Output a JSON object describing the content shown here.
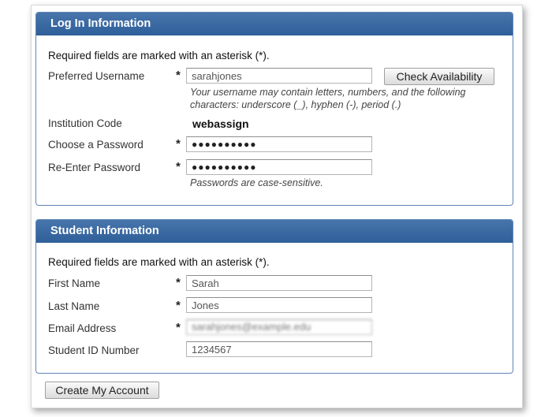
{
  "login_section": {
    "title": "Log In Information",
    "required_note": "Required fields are marked with an asterisk (*).",
    "username": {
      "label": "Preferred Username",
      "required_mark": "*",
      "value": "sarahjones",
      "check_button": "Check Availability",
      "hint_line1": "Your username may contain letters, numbers, and the following",
      "hint_line2": "characters: underscore (_), hyphen (-), period (.)"
    },
    "institution": {
      "label": "Institution Code",
      "value": "webassign"
    },
    "password": {
      "label": "Choose a Password",
      "required_mark": "*",
      "value": "●●●●●●●●●●"
    },
    "password_confirm": {
      "label": "Re-Enter Password",
      "required_mark": "*",
      "value": "●●●●●●●●●●"
    },
    "password_hint": "Passwords are case-sensitive."
  },
  "student_section": {
    "title": "Student Information",
    "required_note": "Required fields are marked with an asterisk (*).",
    "first_name": {
      "label": "First Name",
      "required_mark": "*",
      "value": "Sarah"
    },
    "last_name": {
      "label": "Last Name",
      "required_mark": "*",
      "value": "Jones"
    },
    "email": {
      "label": "Email Address",
      "required_mark": "*",
      "value": "sarahjones@example.edu"
    },
    "student_id": {
      "label": "Student ID Number",
      "value": "1234567"
    }
  },
  "submit_button": "Create My Account",
  "colors": {
    "header_bg": "#3a6aa3",
    "panel_border": "#5f85b5"
  }
}
